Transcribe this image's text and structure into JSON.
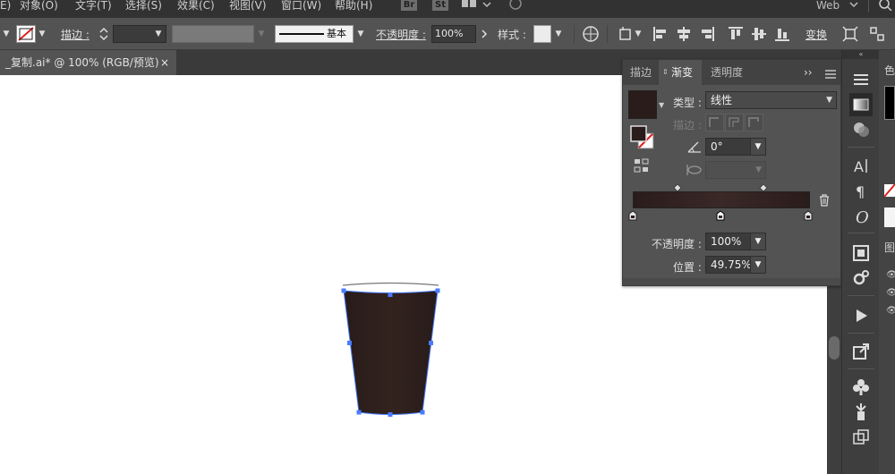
{
  "menu": {
    "items": [
      "E)",
      "对象(O)",
      "文字(T)",
      "选择(S)",
      "效果(C)",
      "视图(V)",
      "窗口(W)",
      "帮助(H)"
    ],
    "br": "Br",
    "st": "St",
    "workspace": "Web"
  },
  "control": {
    "stroke_label": "描边 :",
    "stroke_value": "",
    "brush_label": "基本",
    "opacity_label": "不透明度 :",
    "opacity_value": "100%",
    "style_label": "样式 :",
    "transform_label": "变换"
  },
  "document": {
    "tab_title": "_复制.ai* @ 100% (RGB/预览)",
    "close": "×"
  },
  "gradient_panel": {
    "tabs": [
      "描边",
      "渐变",
      "透明度"
    ],
    "active_tab": "渐变",
    "menu_more": "››",
    "type_label": "类型 :",
    "type_value": "线性",
    "stroke_label": "描边 :",
    "angle_value": "0°",
    "opacity_label": "不透明度 :",
    "opacity_value": "100%",
    "location_label": "位置 :",
    "location_value": "49.75%",
    "swatch_color": "#2a1c1a",
    "gradient_colors": [
      "#2a1c1a",
      "#3a2926",
      "#2a1c1a"
    ]
  },
  "artwork": {
    "cup_fill": "#2b1e1c",
    "selection_color": "#4a7cff"
  },
  "colors": {
    "menubar": "#323232",
    "panel": "#535353",
    "canvas": "#ffffff"
  }
}
